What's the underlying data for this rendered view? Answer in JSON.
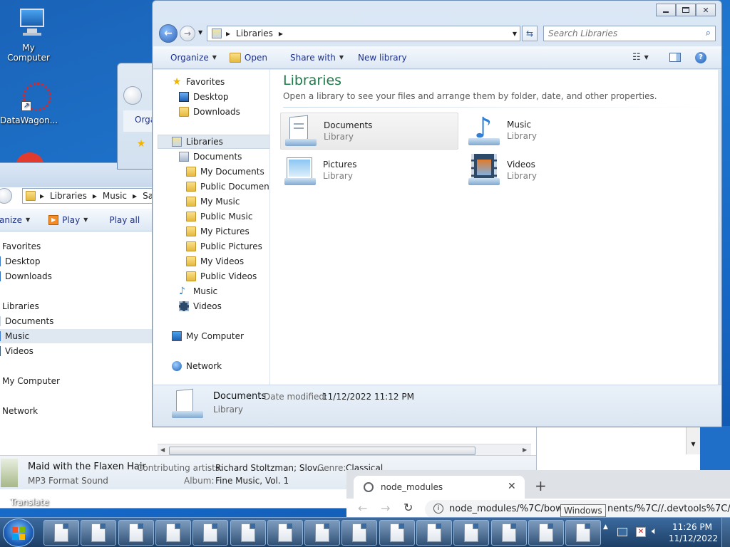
{
  "desktop": {
    "icons": [
      {
        "label": "My Computer",
        "icon": "computer-icon"
      },
      {
        "label": "DataWagon...",
        "icon": "datawagon-icon"
      }
    ],
    "translate_label": "Translate"
  },
  "back_window": {
    "address": [
      "Libraries",
      "Music",
      "Sam"
    ],
    "commands": {
      "organize": "anize",
      "play": "Play",
      "play_all": "Play all"
    },
    "nav": {
      "favorites": "Favorites",
      "desktop": "Desktop",
      "downloads": "Downloads",
      "libraries": "Libraries",
      "documents": "Documents",
      "music": "Music",
      "videos": "Videos",
      "my_computer": "My Computer",
      "network": "Network"
    },
    "details": {
      "title": "Maid with the Flaxen Hair",
      "type": "MP3 Format Sound",
      "contrib_label": "Contributing artists:",
      "contrib_value": "Richard Stoltzman; Slov...",
      "genre_label": "Genre:",
      "genre_value": "Classical",
      "album_label": "Album:",
      "album_value": "Fine Music, Vol. 1"
    }
  },
  "mid_window": {
    "organize": "Orga"
  },
  "front_window": {
    "address": "Libraries",
    "search_placeholder": "Search Libraries",
    "commands": {
      "organize": "Organize",
      "open": "Open",
      "share_with": "Share with",
      "new_library": "New library"
    },
    "nav": {
      "favorites": "Favorites",
      "desktop": "Desktop",
      "downloads": "Downloads",
      "libraries": "Libraries",
      "documents": "Documents",
      "doc_children": [
        "My Documents",
        "Public Documents",
        "My Music",
        "Public Music",
        "My Pictures",
        "Public Pictures",
        "My Videos",
        "Public Videos"
      ],
      "music": "Music",
      "videos": "Videos",
      "my_computer": "My Computer",
      "network": "Network"
    },
    "heading": "Libraries",
    "subheading": "Open a library to see your files and arrange them by folder, date, and other properties.",
    "libraries": [
      {
        "name": "Documents",
        "type": "Library"
      },
      {
        "name": "Music",
        "type": "Library"
      },
      {
        "name": "Pictures",
        "type": "Library"
      },
      {
        "name": "Videos",
        "type": "Library"
      }
    ],
    "details": {
      "name": "Documents",
      "type": "Library",
      "modified_label": "Date modified:",
      "modified_value": "11/12/2022 11:12 PM"
    }
  },
  "browser": {
    "tab_title": "node_modules",
    "url_visible": "node_modules/%7C/bow",
    "url_tail": "nents/%7C//.devtools%7C//.",
    "tooltip": "Windows"
  },
  "taskbar": {
    "time": "11:26 PM",
    "date": "11/12/2022",
    "button_count": 15
  },
  "colors": {
    "accent": "#1e3287",
    "heading": "#1e7a4a",
    "selection": "#dfe7f1"
  }
}
